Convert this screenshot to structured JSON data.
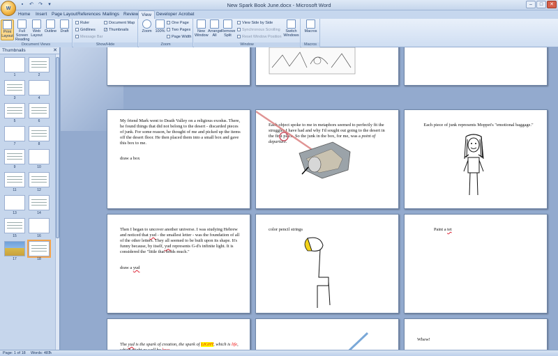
{
  "window": {
    "title": "New Spark Book June.docx - Microsoft Word"
  },
  "office_button": {
    "label": "W"
  },
  "tabs": [
    {
      "label": "Home"
    },
    {
      "label": "Insert"
    },
    {
      "label": "Page Layout"
    },
    {
      "label": "References"
    },
    {
      "label": "Mailings"
    },
    {
      "label": "Review"
    },
    {
      "label": "View"
    },
    {
      "label": "Developer"
    },
    {
      "label": "Acrobat"
    }
  ],
  "ribbon": {
    "document_views": {
      "label": "Document Views",
      "print_layout": "Print Layout",
      "full_screen": "Full Screen Reading",
      "web_layout": "Web Layout",
      "outline": "Outline",
      "draft": "Draft"
    },
    "show_hide": {
      "label": "Show/Hide",
      "ruler": "Ruler",
      "gridlines": "Gridlines",
      "message_bar": "Message Bar",
      "document_map": "Document Map",
      "thumbnails": "Thumbnails"
    },
    "zoom": {
      "label": "Zoom",
      "zoom": "Zoom",
      "pct": "100%",
      "one_page": "One Page",
      "two_pages": "Two Pages",
      "page_width": "Page Width"
    },
    "window": {
      "label": "Window",
      "new_window": "New Window",
      "arrange_all": "Arrange All",
      "split": "Remove Split",
      "side_by_side": "View Side by Side",
      "sync_scroll": "Synchronous Scrolling",
      "reset_pos": "Reset Window Position",
      "switch": "Switch Windows"
    },
    "macros": {
      "label": "Macros",
      "macros": "Macros"
    }
  },
  "thumbnails": {
    "title": "Thumbnails",
    "pages": [
      "1",
      "2",
      "3",
      "4",
      "5",
      "6",
      "7",
      "8",
      "9",
      "10",
      "11",
      "12",
      "13",
      "14",
      "15",
      "16",
      "17",
      "18"
    ],
    "selected": "18"
  },
  "pages": {
    "p1_text": "My friend Mark went to Death Valley on a religious exodus. There, he found things that did not belong to the desert - discarded pieces of junk. For some reason, he thought of me and picked up the items off the desert floor. He then placed them into a small box and gave this box to me.",
    "p1_caption": "draw a box",
    "p2_text_a": "Each object spoke to me in metaphors seemed to perfectly fit the struggles I have had and why I'd sought out going to the desert in the first place. So the junk in the box, for me, was a ",
    "p2_text_em": "point of departure.",
    "p3_text": "Each piece of junk represents Moppet's \"emotional baggage.\"",
    "p4_text_a": "Then I began to uncover another universe. I was studying Hebrew and noticed that ",
    "p4_yud1": "yud",
    "p4_text_b": " - the smallest letter - was the foundation of all of the other letters. They all seemed to be built upon its shape. It's funny because, by itself, ",
    "p4_yud2": "yud",
    "p4_text_c": " represents G-d's infinite light. It is considered the \"little that holds much.\"",
    "p4_caption_a": "draw a ",
    "p4_caption_yud": "yud",
    "p5_text": "color pencil strings",
    "p6_text_a": "Paint a ",
    "p6_text_tet": "tet",
    "p7_text_a": "The ",
    "p7_yud": "yud",
    "p7_text_b": " is the ",
    "p7_spark": "spark",
    "p7_text_c": " of creation, the ",
    "p7_spark2": "spark",
    "p7_text_d": " of ",
    "p7_light": "LIGHT",
    "p7_text_e": ", which is ",
    "p7_life": "life",
    "p7_text_f": ", which might as well be ",
    "p7_love": "love",
    "p9_text": "Whew!"
  },
  "status": {
    "page": "Page: 1 of 18",
    "words": "Words: 481"
  },
  "colors": {
    "accent_selected": "#f5a34a",
    "highlight": "#ffff00"
  }
}
